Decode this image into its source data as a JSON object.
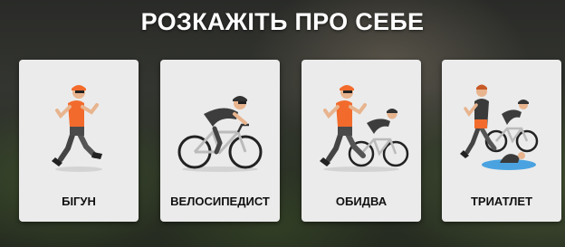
{
  "title": "РОЗКАЖІТЬ ПРО СЕБЕ",
  "accent_color": "#f26b2c",
  "options": [
    {
      "label": "БІГУН",
      "icon": "runner-icon"
    },
    {
      "label": "ВЕЛОСИПЕДИСТ",
      "icon": "cyclist-icon"
    },
    {
      "label": "ОБИДВА",
      "icon": "runner-and-cyclist-icon"
    },
    {
      "label": "ТРИАТЛЕТ",
      "icon": "triathlete-icon"
    }
  ]
}
